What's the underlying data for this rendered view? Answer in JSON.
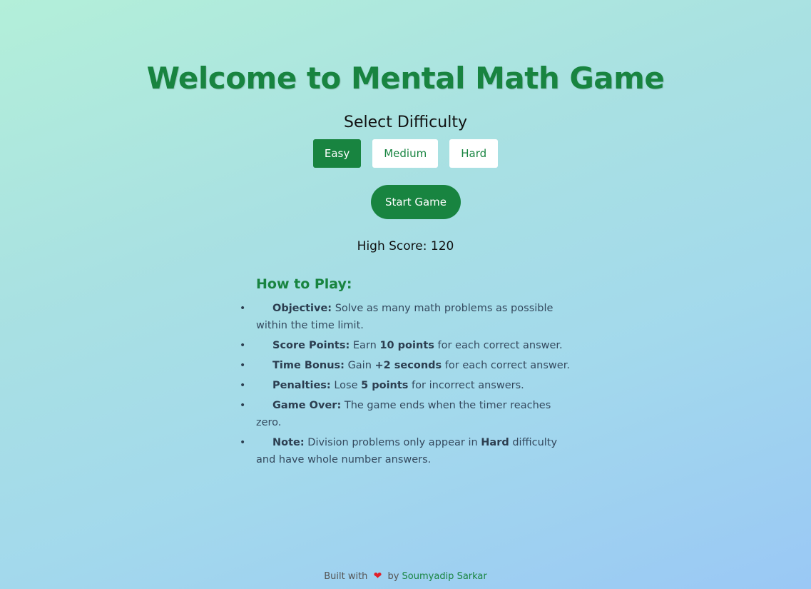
{
  "page": {
    "title": "Welcome to Mental Math Game",
    "subtitle": "Select Difficulty"
  },
  "difficulty": {
    "options": [
      {
        "label": "Easy",
        "active": true
      },
      {
        "label": "Medium",
        "active": false
      },
      {
        "label": "Hard",
        "active": false
      }
    ]
  },
  "start_button": {
    "label": "Start Game"
  },
  "high_score": {
    "text": "High Score: 120"
  },
  "how_to_play": {
    "heading": "How to Play:",
    "items": [
      {
        "label": "Objective:",
        "parts": [
          "Solve as many math problems as possible within the time limit."
        ]
      },
      {
        "label": "Score Points:",
        "pre": "Earn ",
        "bold": "10 points",
        "post": " for each correct answer."
      },
      {
        "label": "Time Bonus:",
        "pre": "Gain ",
        "bold": "+2 seconds",
        "post": " for each correct answer."
      },
      {
        "label": "Penalties:",
        "pre": "Lose ",
        "bold": "5 points",
        "post": " for incorrect answers."
      },
      {
        "label": "Game Over:",
        "pre": "The game ends when the timer reaches zero.",
        "bold": "",
        "post": ""
      },
      {
        "label": "Note:",
        "pre": "Division problems only appear in ",
        "bold": "Hard",
        "post": " difficulty and have whole number answers."
      }
    ]
  },
  "footer": {
    "prefix": "Built with",
    "heart_icon": "heart-icon",
    "by": "by",
    "author": "Soumyadip Sarkar"
  },
  "colors": {
    "accent": "#188440",
    "background_start": "#b3efd9",
    "background_end": "#9ac8f5"
  }
}
